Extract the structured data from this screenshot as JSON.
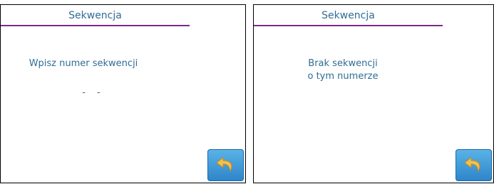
{
  "left": {
    "title": "Sekwencja",
    "prompt": "Wpisz numer sekwencji",
    "input_value": "- -"
  },
  "right": {
    "title": "Sekwencja",
    "message_line1": "Brak sekwencji",
    "message_line2": "o tym numerze"
  },
  "icons": {
    "back": "back-arrow-icon"
  },
  "colors": {
    "text": "#2f6d94",
    "accent_rule": "#7b2a8b",
    "button": "#3f9bd8",
    "arrow": "#f2c14e"
  }
}
